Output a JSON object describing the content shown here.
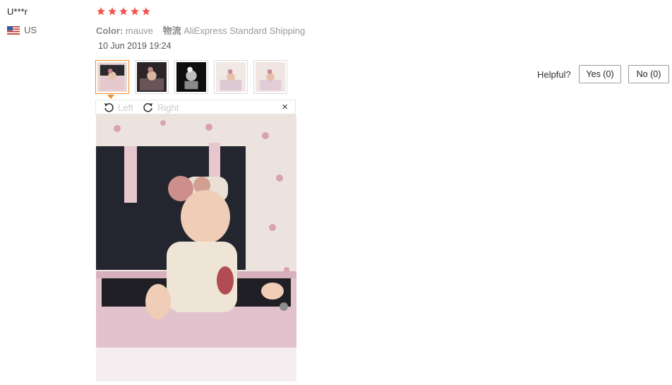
{
  "review": {
    "username": "U***r",
    "country": "US",
    "rating": 5,
    "color_label": "Color:",
    "color_value": "mauve",
    "shipping_label": "物流",
    "shipping_value": "AliExpress Standard Shipping",
    "date": "10 Jun 2019 19:24"
  },
  "viewer": {
    "rotate_left": "Left",
    "rotate_right": "Right",
    "close": "×"
  },
  "helpful": {
    "label": "Helpful?",
    "yes": "Yes (0)",
    "no": "No (0)"
  },
  "icons": {
    "flag": "us-flag-icon",
    "star": "star-icon",
    "rotate_left": "rotate-left-icon",
    "rotate_right": "rotate-right-icon",
    "close": "close-icon"
  },
  "colors": {
    "star": "#f5524d",
    "active_thumb": "#f18c2a",
    "muted_text": "#999999"
  }
}
